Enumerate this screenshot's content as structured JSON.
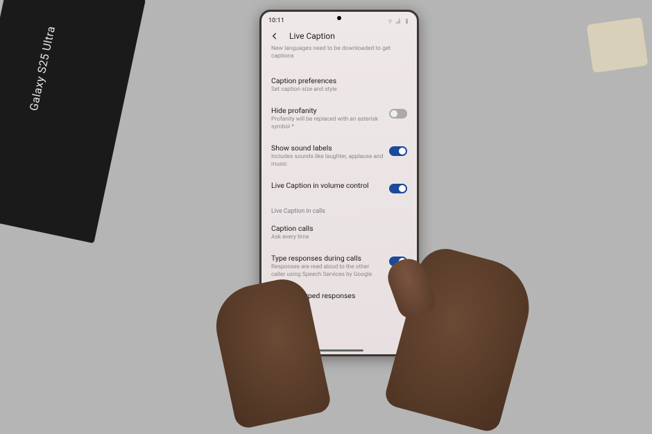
{
  "box": {
    "product": "Galaxy S25 Ultra"
  },
  "status": {
    "time": "10:11"
  },
  "header": {
    "title": "Live Caption"
  },
  "scroll_hint": "New languages need to be downloaded to get captions",
  "items": {
    "caption_prefs": {
      "title": "Caption preferences",
      "sub": "Set caption size and style"
    },
    "hide_profanity": {
      "title": "Hide profanity",
      "sub": "Profanity will be replaced with an asterisk symbol *",
      "on": false
    },
    "sound_labels": {
      "title": "Show sound labels",
      "sub": "Includes sounds like laughter, applause and music",
      "on": true
    },
    "volume_control": {
      "title": "Live Caption in volume control",
      "on": true
    }
  },
  "section": "Live Caption in calls",
  "calls": {
    "caption_calls": {
      "title": "Caption calls",
      "sub": "Ask every time"
    },
    "type_responses": {
      "title": "Type responses during calls",
      "sub": "Responses are read aloud to the other caller using Speech Services by Google",
      "on": true
    },
    "voice": {
      "title": "Voice for typed responses"
    }
  }
}
